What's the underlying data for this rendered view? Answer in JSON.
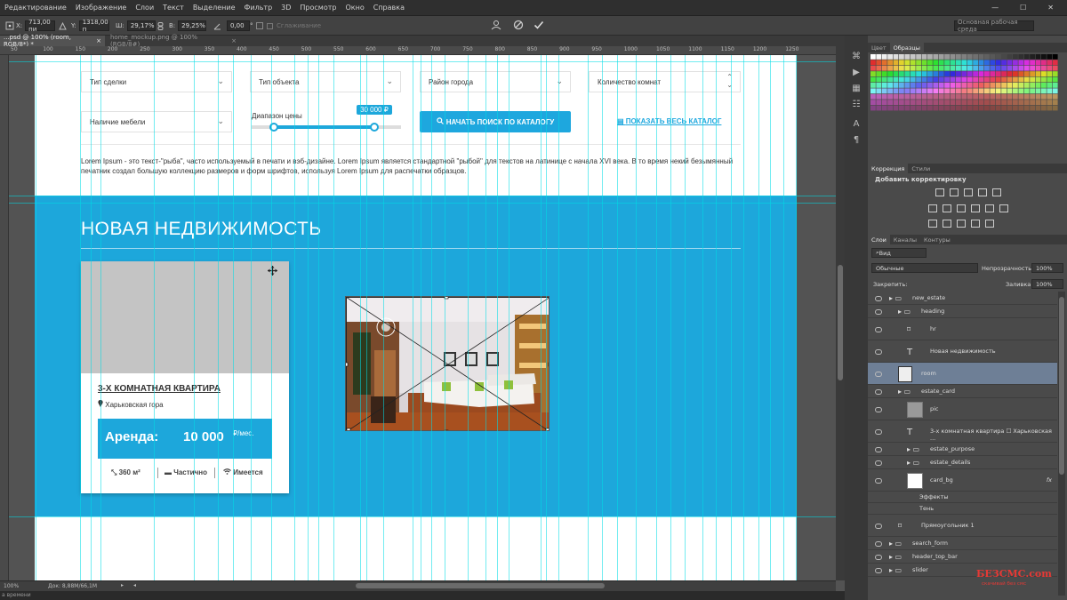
{
  "menu": [
    "Редактирование",
    "Изображение",
    "Слои",
    "Текст",
    "Выделение",
    "Фильтр",
    "3D",
    "Просмотр",
    "Окно",
    "Справка"
  ],
  "window_buttons": {
    "minimize": "—",
    "maximize": "☐",
    "close": "✕"
  },
  "options_bar": {
    "x_label": "X:",
    "x_value": "713,00 пи",
    "y_label": "Y:",
    "y_value": "1318,00 п",
    "w_label": "Ш:",
    "w_value": "29,17%",
    "h_label": "В:",
    "h_value": "29,25%",
    "angle_value": "0,00",
    "angle_unit": "°",
    "antialias_label": "Сглаживание",
    "workspace": "Основная рабочая среда"
  },
  "doc_tabs": [
    {
      "label": "...psd @ 100% (room, RGB/8*) *",
      "close": "×",
      "active": true
    },
    {
      "label": "home_mockup.png @ 100% (RGB/8#)",
      "close": "×",
      "active": false
    }
  ],
  "ruler_ticks": [
    "50",
    "100",
    "150",
    "200",
    "250",
    "300",
    "350",
    "400",
    "450",
    "500",
    "550",
    "600",
    "650",
    "700",
    "750",
    "800",
    "850",
    "900",
    "950",
    "1000",
    "1050",
    "1100",
    "1150",
    "1200",
    "1250"
  ],
  "search_form": {
    "deal_type": "Тип сделки",
    "object_type": "Тип объекта",
    "district": "Район города",
    "rooms": "Количество комнат",
    "furniture": "Наличие мебели",
    "price_range_label": "Диапазон цены",
    "price_tooltip": "30 000 ₽",
    "price_range_min": 0.15,
    "price_range_max": 0.82,
    "search_button": "НАЧАТЬ ПОИСК ПО КАТАЛОГУ",
    "catalog_link": "ПОКАЗАТЬ ВЕСЬ КАТАЛОГ"
  },
  "lorem": "Lorem Ipsum - это текст-\"рыба\", часто используемый в печати и вэб-дизайне. Lorem Ipsum является стандартной \"рыбой\" для текстов на латинице с начала XVI века. В то время некий безымянный печатник создал большую коллекцию размеров и форм шрифтов, используя Lorem Ipsum для распечатки образцов.",
  "section": {
    "title": "НОВАЯ НЕДВИЖИМОСТЬ",
    "card": {
      "title": "3-Х КОМНАТНАЯ КВАРТИРА",
      "address": "Харьковская гора",
      "rent_label": "Аренда:",
      "price": "10 000",
      "per": "₽/мес.",
      "area": "360 м²",
      "furniture": "Частично",
      "wifi": "Имеется"
    }
  },
  "status": {
    "zoom": "100%",
    "doc_size": "Док: 8,88M/66,1M",
    "bottom_left": "а времени"
  },
  "colors": {
    "accent": "#1da7db",
    "layer_selected": "#6e7f96",
    "watermark": "#e53935"
  },
  "panels": {
    "swatch_tabs": [
      "Цвет",
      "Образцы"
    ],
    "correction_tabs": [
      "Коррекция",
      "Стили"
    ],
    "add_correction": "Добавить корректировку",
    "layers_tabs": [
      "Слои",
      "Каналы",
      "Контуры"
    ],
    "kind_filter": "Вид",
    "blend_mode": "Обычные",
    "opacity_label": "Непрозрачность:",
    "opacity_value": "100%",
    "lock_label": "Закрепить:",
    "fill_label": "Заливка:",
    "fill_value": "100%",
    "fx_label": "fx",
    "layers": [
      {
        "name": "new_estate",
        "type": "folder",
        "indent": 0,
        "selected": false
      },
      {
        "name": "heading",
        "type": "folder",
        "indent": 1,
        "selected": false
      },
      {
        "name": "hr",
        "type": "shape",
        "indent": 2,
        "selected": false
      },
      {
        "name": "Новая недвижимость",
        "type": "text",
        "indent": 2,
        "selected": false
      },
      {
        "name": "room",
        "type": "smart",
        "indent": 1,
        "selected": true
      },
      {
        "name": "estate_card",
        "type": "folder",
        "indent": 1,
        "selected": false
      },
      {
        "name": "pic",
        "type": "image",
        "indent": 2,
        "selected": false
      },
      {
        "name": "3-х  комнатная квартира ☐ Харьковская ...",
        "type": "text",
        "indent": 2,
        "selected": false
      },
      {
        "name": "estate_purpose",
        "type": "folder",
        "indent": 2,
        "selected": false
      },
      {
        "name": "estate_details",
        "type": "folder",
        "indent": 2,
        "selected": false
      },
      {
        "name": "card_bg",
        "type": "image",
        "indent": 2,
        "selected": false
      },
      {
        "name": "Эффекты",
        "type": "effect",
        "indent": 3,
        "selected": false
      },
      {
        "name": "Тень",
        "type": "effect",
        "indent": 3,
        "selected": false
      },
      {
        "name": "Прямоугольник 1",
        "type": "shape",
        "indent": 1,
        "selected": false
      },
      {
        "name": "search_form",
        "type": "folder",
        "indent": 0,
        "selected": false
      },
      {
        "name": "header_top_bar",
        "type": "folder",
        "indent": 0,
        "selected": false
      },
      {
        "name": "slider",
        "type": "folder",
        "indent": 0,
        "selected": false
      }
    ]
  },
  "watermark": {
    "line1": "БЕЗСМС.com",
    "line2": "скачивай без смс"
  }
}
